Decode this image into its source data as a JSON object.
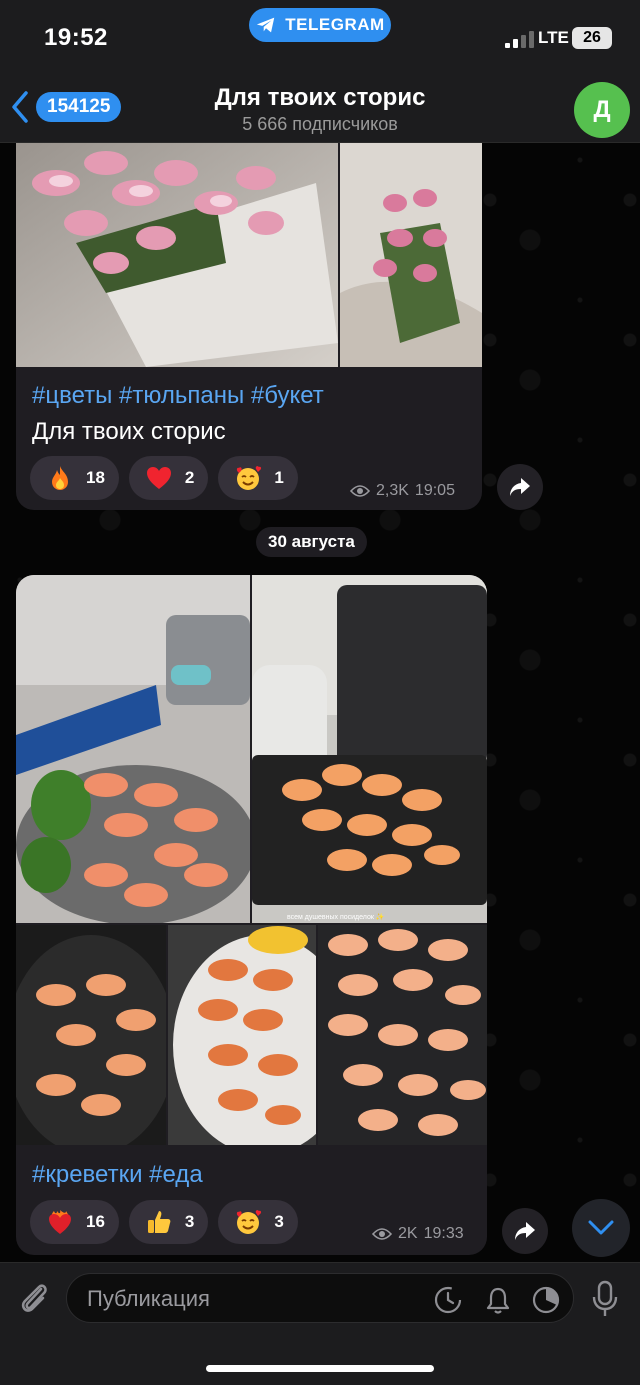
{
  "status_bar": {
    "time": "19:52",
    "app_pill": "TELEGRAM",
    "network": "LTE",
    "battery": "26"
  },
  "header": {
    "back_badge": "154125",
    "title": "Для твоих сторис",
    "subtitle": "5 666 подписчиков",
    "avatar_letter": "Д"
  },
  "posts": [
    {
      "caption_tags": "#цветы #тюльпаны #букет",
      "caption_text": "Для твоих сторис",
      "reactions": [
        {
          "emoji": "fire",
          "count": "18"
        },
        {
          "emoji": "red-heart",
          "count": "2"
        },
        {
          "emoji": "smiling-face-with-hearts",
          "count": "1"
        }
      ],
      "views": "2,3K",
      "time": "19:05"
    },
    {
      "caption_tags": "#креветки #еда",
      "caption_text": "",
      "reactions": [
        {
          "emoji": "heart-on-fire",
          "count": "16"
        },
        {
          "emoji": "thumbs-up",
          "count": "3"
        },
        {
          "emoji": "smiling-face-with-hearts",
          "count": "3"
        }
      ],
      "views": "2K",
      "time": "19:33"
    }
  ],
  "date_separator": "30 августа",
  "photo_watermark": "всем душевных посиделок ✨",
  "composer": {
    "placeholder": "Публикация"
  },
  "colors": {
    "accent": "#2f8ff0",
    "hashtag": "#5aa6f2",
    "bubble": "#1f1d22",
    "avatar": "#56c04f"
  }
}
